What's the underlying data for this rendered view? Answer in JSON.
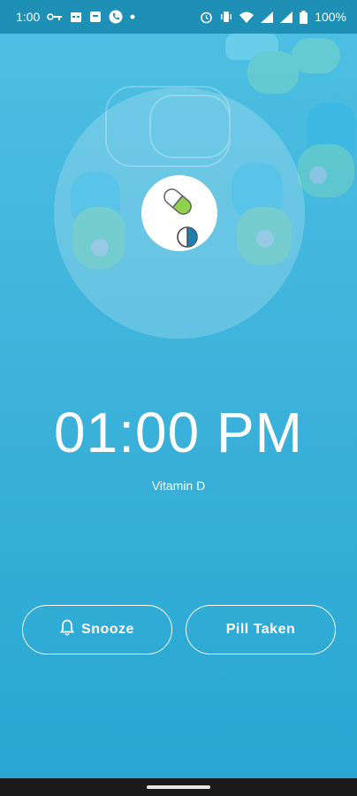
{
  "status_bar": {
    "time": "1:00",
    "battery": "100%"
  },
  "reminder": {
    "time": "01:00 PM",
    "medication": "Vitamin D"
  },
  "actions": {
    "snooze_label": "Snooze",
    "taken_label": "Pill Taken"
  },
  "colors": {
    "background_top": "#4ec0e2",
    "background_bottom": "#27a6d1",
    "status_bar": "#1e8fb5",
    "pill_green": "#8fd14f",
    "pill_blue": "#1f7fb0"
  }
}
